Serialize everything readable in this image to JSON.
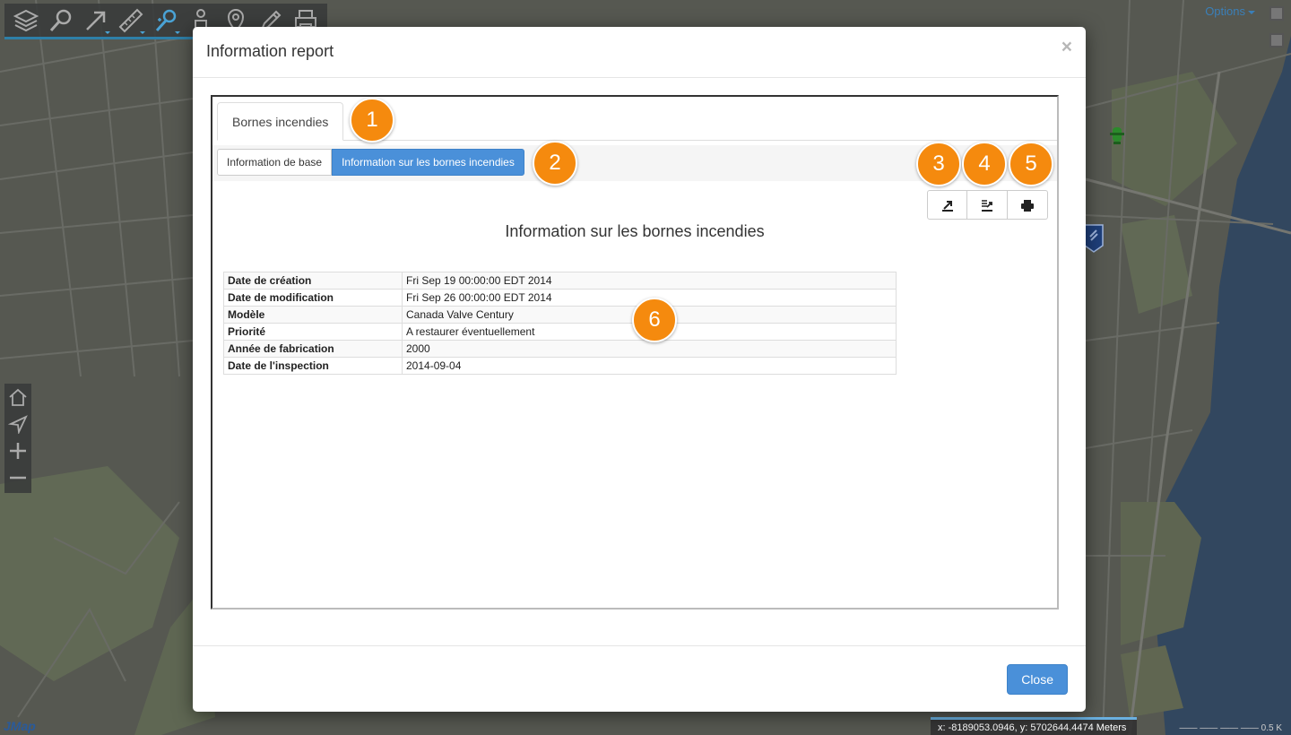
{
  "toolbar": {
    "tools": [
      "layers-icon",
      "search-icon",
      "select-arrow-icon",
      "measure-icon",
      "identify-icon",
      "person-icon",
      "location-pin-icon",
      "edit-icon",
      "print-icon"
    ],
    "active_color": "#4aa3d6"
  },
  "map": {
    "options_label": "Options",
    "coords_readout": "x: -8189053.0946, y: 5702644.4474 Meters",
    "scale_label": "0.5 K",
    "logo_text": "JMap"
  },
  "left_nav": {
    "items": [
      "home-icon",
      "navigate-icon",
      "zoom-in-icon",
      "zoom-out-icon"
    ]
  },
  "modal": {
    "title": "Information report",
    "close_symbol": "×",
    "tab_label": "Bornes incendies",
    "segments": [
      "Information de base",
      "Information sur les bornes incendies"
    ],
    "action_icons": [
      "export-icon",
      "export-table-icon",
      "print-icon"
    ],
    "report_title": "Information sur les bornes incendies",
    "rows": [
      {
        "label": "Date de création",
        "value": "Fri Sep 19 00:00:00 EDT 2014"
      },
      {
        "label": "Date de modification",
        "value": "Fri Sep 26 00:00:00 EDT 2014"
      },
      {
        "label": "Modèle",
        "value": "Canada Valve Century"
      },
      {
        "label": "Priorité",
        "value": "A restaurer éventuellement"
      },
      {
        "label": "Année de fabrication",
        "value": "2000"
      },
      {
        "label": "Date de l'inspection",
        "value": "2014-09-04"
      }
    ],
    "footer_close_label": "Close",
    "accent_color": "#4a90d9"
  },
  "callouts": [
    "1",
    "2",
    "3",
    "4",
    "5",
    "6"
  ],
  "callout_color": "#f58a0e"
}
